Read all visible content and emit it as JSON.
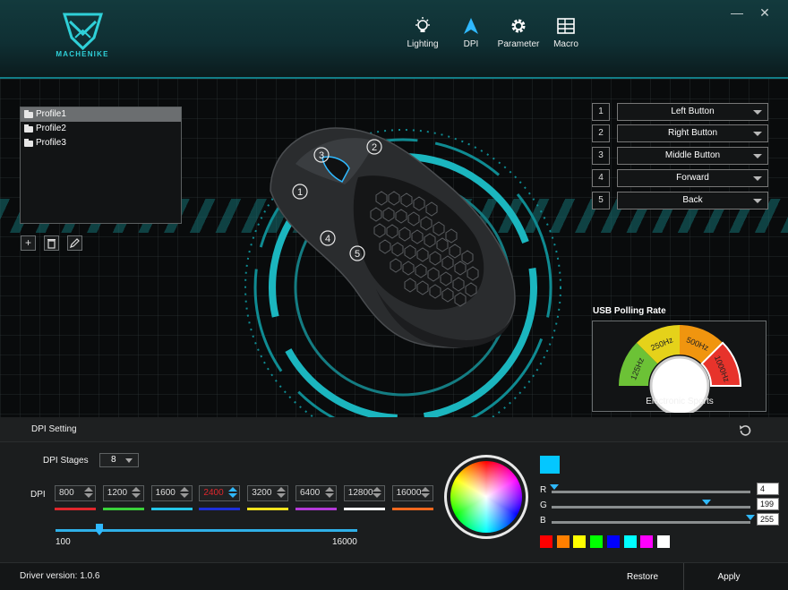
{
  "app": {
    "logo_text": "MACHENIKE",
    "window_controls": {
      "minimize": "—",
      "close": "✕"
    }
  },
  "nav": {
    "tabs": [
      {
        "label": "Lighting",
        "icon": "lightbulb-icon"
      },
      {
        "label": "DPI",
        "icon": "arrow-cursor-icon"
      },
      {
        "label": "Parameter",
        "icon": "gear-icon"
      },
      {
        "label": "Macro",
        "icon": "grid-icon"
      }
    ],
    "active": "DPI"
  },
  "profiles": {
    "items": [
      "Profile1",
      "Profile2",
      "Profile3"
    ],
    "selected": "Profile1",
    "tools": {
      "add": "+",
      "delete": "trash-icon",
      "edit": "pencil-icon"
    }
  },
  "mouse": {
    "callouts": [
      "1",
      "2",
      "3",
      "4",
      "5"
    ]
  },
  "button_map": [
    {
      "num": "1",
      "action": "Left Button"
    },
    {
      "num": "2",
      "action": "Right Button"
    },
    {
      "num": "3",
      "action": "Middle Button"
    },
    {
      "num": "4",
      "action": "Forward"
    },
    {
      "num": "5",
      "action": "Back"
    }
  ],
  "polling": {
    "title": "USB Polling Rate",
    "rates": [
      "125Hz",
      "250Hz",
      "500Hz",
      "1000Hz"
    ],
    "mode": "Electronic Sports",
    "colors": {
      "125Hz": "#6cc236",
      "250Hz": "#e5d21a",
      "500Hz": "#f0950f",
      "1000Hz": "#e7332b"
    }
  },
  "dpi": {
    "title": "DPI Setting",
    "stages_label": "DPI Stages",
    "stages_value": "8",
    "row_label": "DPI",
    "values": [
      "800",
      "1200",
      "1600",
      "2400",
      "3200",
      "6400",
      "12800",
      "16000"
    ],
    "active_index": 3,
    "stage_colors": [
      "#e0262c",
      "#3ad13a",
      "#25c6e8",
      "#1d2fd8",
      "#f0e21e",
      "#b43ad8",
      "#ffffff",
      "#f2681f"
    ],
    "slider_min": "100",
    "slider_max": "16000",
    "slider_value": 2400
  },
  "color": {
    "current": "#04c7ff",
    "r": "4",
    "g": "199",
    "b": "255",
    "r_label": "R",
    "g_label": "G",
    "b_label": "B",
    "presets": [
      "#ff0000",
      "#ff7f00",
      "#ffff00",
      "#00ff00",
      "#0000ff",
      "#00ffff",
      "#ff00ff",
      "#ffffff"
    ]
  },
  "footer": {
    "driver_version": "Driver version: 1.0.6",
    "restore": "Restore",
    "apply": "Apply"
  }
}
